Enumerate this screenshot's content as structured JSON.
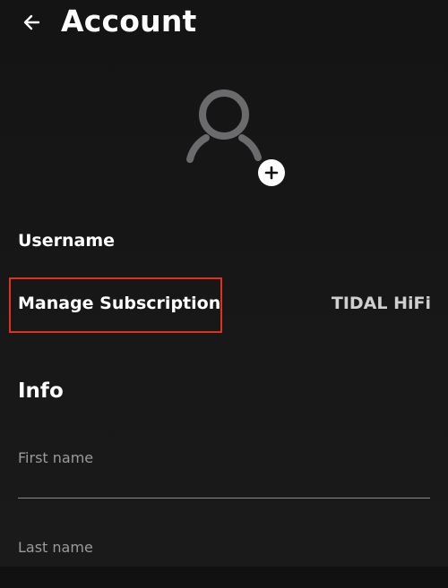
{
  "header": {
    "title": "Account",
    "back_icon": "arrow-left-icon"
  },
  "profile": {
    "avatar_icon": "person-outline-icon",
    "add_icon": "plus-icon"
  },
  "rows": {
    "username_label": "Username",
    "subscription_label": "Manage Subscription",
    "subscription_value": "TIDAL HiFi"
  },
  "info": {
    "section_title": "Info",
    "first_name_label": "First name",
    "first_name_value": "",
    "last_name_label": "Last name",
    "last_name_value": ""
  },
  "colors": {
    "background": "#141414",
    "highlight": "#e0301e",
    "muted_text": "#9a9a9a",
    "avatar_stroke": "#6b6b6e"
  }
}
